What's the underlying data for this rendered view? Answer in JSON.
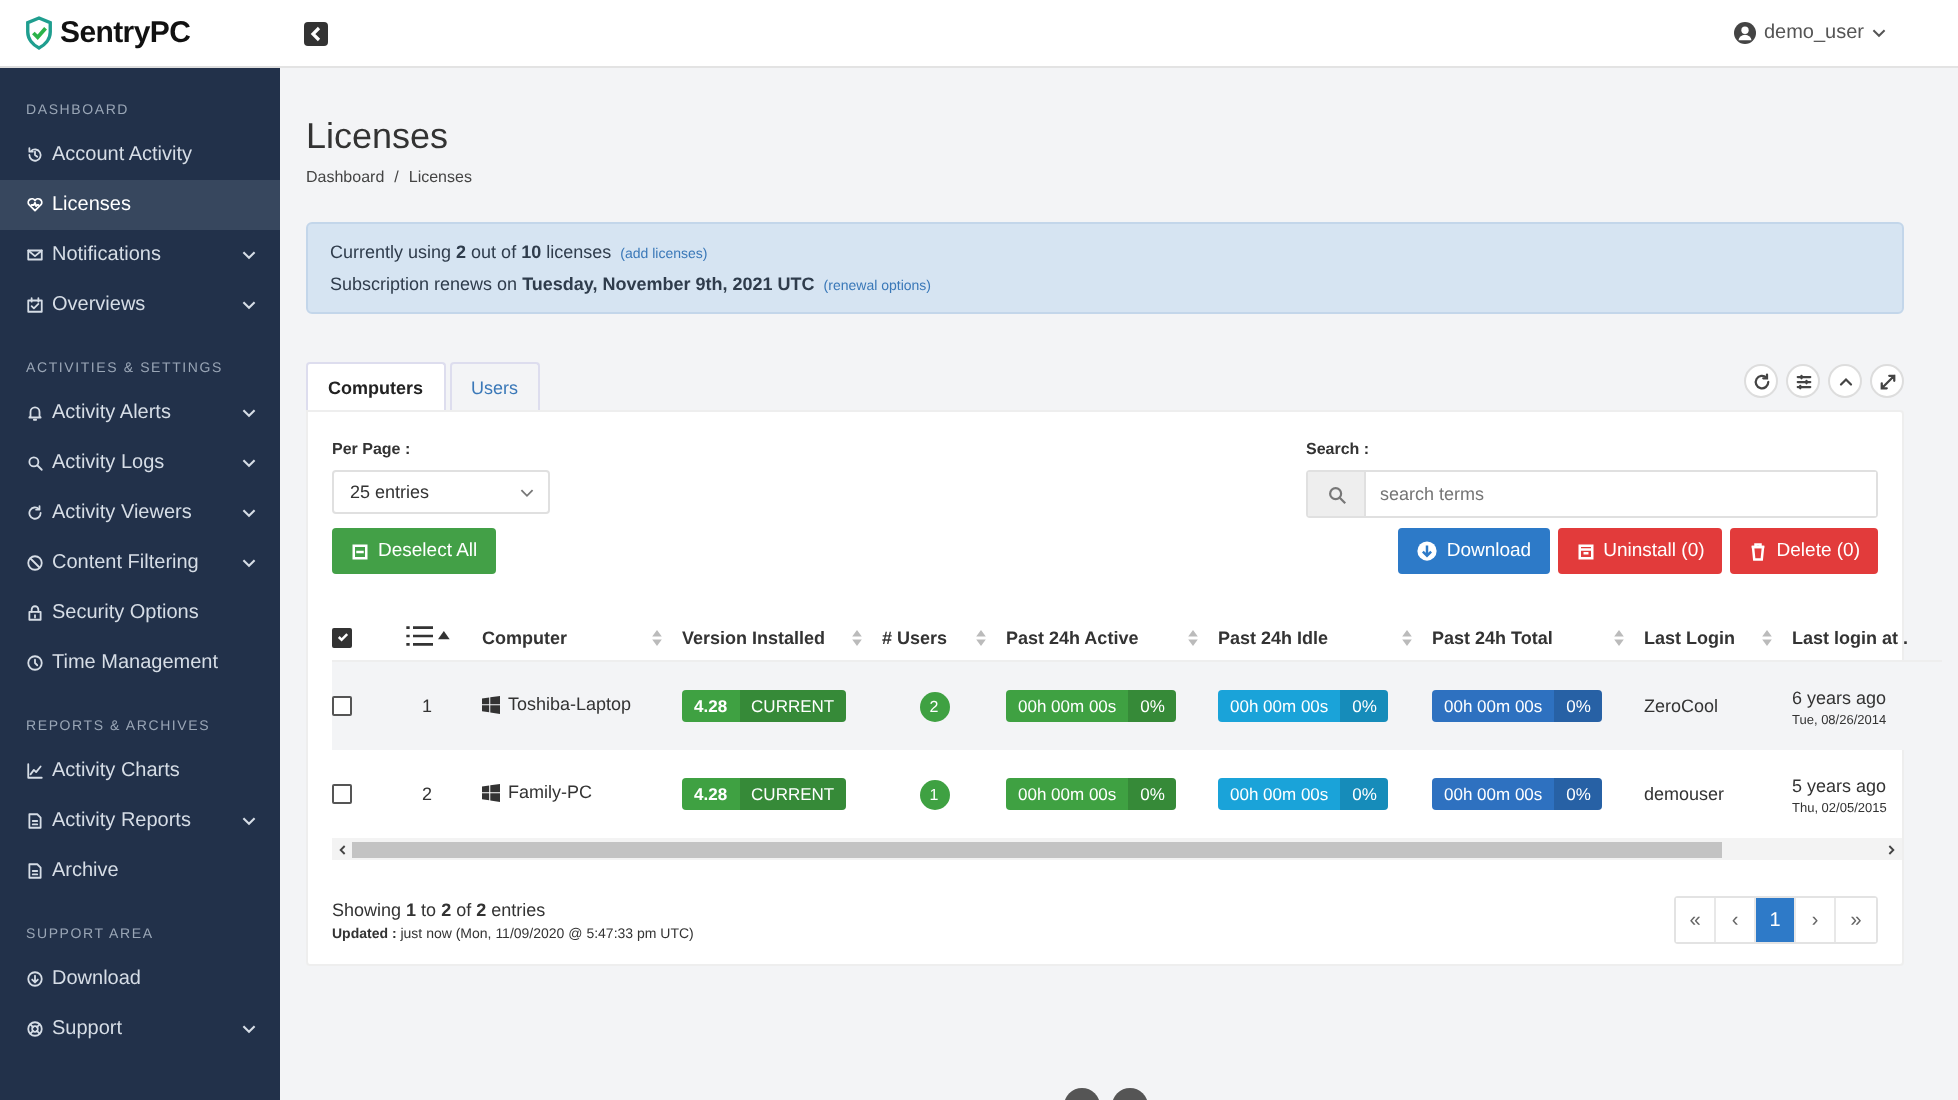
{
  "brand": "SentryPC",
  "sidebar": {
    "sections": [
      {
        "title": "DASHBOARD",
        "items": [
          {
            "label": "Account Activity",
            "selected": false,
            "expandable": false
          },
          {
            "label": "Licenses",
            "selected": true,
            "expandable": false
          },
          {
            "label": "Notifications",
            "selected": false,
            "expandable": true
          },
          {
            "label": "Overviews",
            "selected": false,
            "expandable": true
          }
        ]
      },
      {
        "title": "ACTIVITIES & SETTINGS",
        "items": [
          {
            "label": "Activity Alerts",
            "selected": false,
            "expandable": true
          },
          {
            "label": "Activity Logs",
            "selected": false,
            "expandable": true
          },
          {
            "label": "Activity Viewers",
            "selected": false,
            "expandable": true
          },
          {
            "label": "Content Filtering",
            "selected": false,
            "expandable": true
          },
          {
            "label": "Security Options",
            "selected": false,
            "expandable": false
          },
          {
            "label": "Time Management",
            "selected": false,
            "expandable": false
          }
        ]
      },
      {
        "title": "REPORTS & ARCHIVES",
        "items": [
          {
            "label": "Activity Charts",
            "selected": false,
            "expandable": false
          },
          {
            "label": "Activity Reports",
            "selected": false,
            "expandable": true
          },
          {
            "label": "Archive",
            "selected": false,
            "expandable": false
          }
        ]
      },
      {
        "title": "SUPPORT AREA",
        "items": [
          {
            "label": "Download",
            "selected": false,
            "expandable": false
          },
          {
            "label": "Support",
            "selected": false,
            "expandable": true
          }
        ]
      }
    ]
  },
  "header": {
    "user": "demo_user"
  },
  "page": {
    "title": "Licenses",
    "breadcrumb": [
      "Dashboard",
      "Licenses"
    ],
    "breadcrumb_separator": "/"
  },
  "notice": [
    {
      "text": "Currently using **2** out of **10** licenses",
      "link": "(add licenses)"
    },
    {
      "text": "Subscription renews on **Tuesday, November 9th, 2021 UTC**",
      "link": "(renewal options)"
    }
  ],
  "tabs": [
    {
      "label": "Computers",
      "selected": true
    },
    {
      "label": "Users",
      "selected": false
    }
  ],
  "per_page": {
    "label": "Per Page :",
    "value": "25 entries"
  },
  "search": {
    "label": "Search :",
    "placeholder": "search terms"
  },
  "buttons": [
    {
      "label": "Deselect All",
      "kind": "deselect"
    },
    {
      "label": "Download",
      "kind": "download"
    },
    {
      "label": "Uninstall (0)",
      "kind": "uninstall"
    },
    {
      "label": "Delete (0)",
      "kind": "delete"
    }
  ],
  "table": {
    "select_all_checked": true,
    "columns": [
      "Computer",
      "Version Installed",
      "# Users",
      "Past 24h Active",
      "Past 24h Idle",
      "Past 24h Total",
      "Last Login",
      "Last login at ."
    ],
    "rows": [
      {
        "checked": false,
        "index": "1",
        "computer": "Toshiba-Laptop",
        "version": "4.28",
        "version_status": "CURRENT",
        "users": "2",
        "active": [
          "00h 00m 00s",
          "0%"
        ],
        "idle": [
          "00h 00m 00s",
          "0%"
        ],
        "total": [
          "00h 00m 00s",
          "0%"
        ],
        "last_login": "ZeroCool",
        "ago": "6 years ago",
        "date": "Tue, 08/26/2014"
      },
      {
        "checked": false,
        "index": "2",
        "computer": "Family-PC",
        "version": "4.28",
        "version_status": "CURRENT",
        "users": "1",
        "active": [
          "00h 00m 00s",
          "0%"
        ],
        "idle": [
          "00h 00m 00s",
          "0%"
        ],
        "total": [
          "00h 00m 00s",
          "0%"
        ],
        "last_login": "demouser",
        "ago": "5 years ago",
        "date": "Thu, 02/05/2015"
      }
    ]
  },
  "footer": {
    "showing": "Showing **1** to **2** of **2** entries",
    "updated_label": "Updated :",
    "updated": "just now (Mon, 11/09/2020 @ 5:47:33 pm UTC)"
  },
  "pagination": [
    {
      "label": "«",
      "selected": false
    },
    {
      "label": "‹",
      "selected": false
    },
    {
      "label": "1",
      "selected": true
    },
    {
      "label": "›",
      "selected": false
    },
    {
      "label": "»",
      "selected": false
    }
  ]
}
